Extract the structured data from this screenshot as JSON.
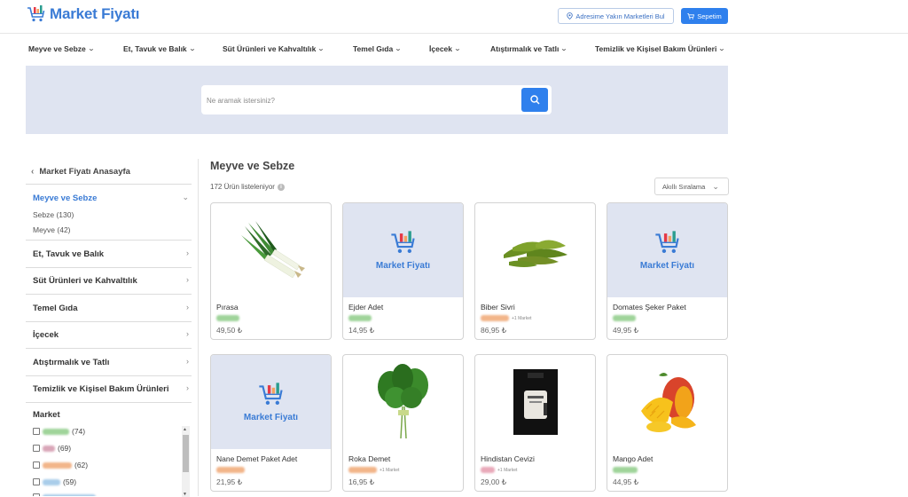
{
  "app": {
    "logo_text": "Market Fiyatı",
    "brand_color": "#3a7bd5",
    "accent_color": "#2f80ed"
  },
  "header": {
    "location_button": "Adresime Yakın Marketleri Bul",
    "cart_button": "Sepetim"
  },
  "nav": {
    "items": [
      {
        "label": "Meyve ve Sebze"
      },
      {
        "label": "Et, Tavuk ve Balık"
      },
      {
        "label": "Süt Ürünleri ve Kahvaltılık"
      },
      {
        "label": "Temel Gıda"
      },
      {
        "label": "İçecek"
      },
      {
        "label": "Atıştırmalık ve Tatlı"
      },
      {
        "label": "Temizlik ve Kişisel Bakım Ürünleri"
      }
    ]
  },
  "search": {
    "placeholder": "Ne aramak istersiniz?",
    "value": ""
  },
  "sidebar": {
    "back_label": "Market Fiyatı Anasayfa",
    "active_category": "Meyve ve Sebze",
    "subcategories": [
      {
        "label": "Sebze (130)"
      },
      {
        "label": "Meyve (42)"
      }
    ],
    "categories": [
      {
        "label": "Et, Tavuk ve Balık"
      },
      {
        "label": "Süt Ürünleri ve Kahvaltılık"
      },
      {
        "label": "Temel Gıda"
      },
      {
        "label": "İçecek"
      },
      {
        "label": "Atıştırmalık ve Tatlı"
      },
      {
        "label": "Temizlik ve Kişisel Bakım Ürünleri"
      }
    ],
    "market_title": "Market",
    "markets": [
      {
        "count": "(74)",
        "color": "#9fd49a"
      },
      {
        "count": "(69)",
        "color": "#d9a6b8"
      },
      {
        "count": "(62)",
        "color": "#f2b58a"
      },
      {
        "count": "(59)",
        "color": "#a9cdea"
      }
    ]
  },
  "main": {
    "title": "Meyve ve Sebze",
    "count_text": "172 Ürün listeleniyor",
    "sort_label": "Akıllı Sıralama"
  },
  "products": [
    {
      "name": "Pırasa",
      "price": "49,50 ₺",
      "image": "leek",
      "more": "",
      "badge_color": "#9fd49a"
    },
    {
      "name": "Ejder Adet",
      "price": "14,95 ₺",
      "image": "placeholder",
      "more": "",
      "badge_color": "#9fd49a"
    },
    {
      "name": "Biber Sivri",
      "price": "86,95 ₺",
      "image": "green-peppers",
      "more": "+1 Market",
      "badge_color": "#f2b58a"
    },
    {
      "name": "Domates Şeker Paket",
      "price": "49,95 ₺",
      "image": "placeholder",
      "more": "",
      "badge_color": "#9fd49a"
    },
    {
      "name": "Nane Demet Paket Adet",
      "price": "21,95 ₺",
      "image": "placeholder",
      "more": "",
      "badge_color": "#f2b58a"
    },
    {
      "name": "Roka Demet",
      "price": "16,95 ₺",
      "image": "arugula",
      "more": "+1 Market",
      "badge_color": "#f2b58a"
    },
    {
      "name": "Hindistan Cevizi",
      "price": "29,00 ₺",
      "image": "coconut-pack",
      "more": "+1 Market",
      "badge_color": "#e9a9b9"
    },
    {
      "name": "Mango Adet",
      "price": "44,95 ₺",
      "image": "mango",
      "more": "",
      "badge_color": "#9fd49a"
    }
  ]
}
